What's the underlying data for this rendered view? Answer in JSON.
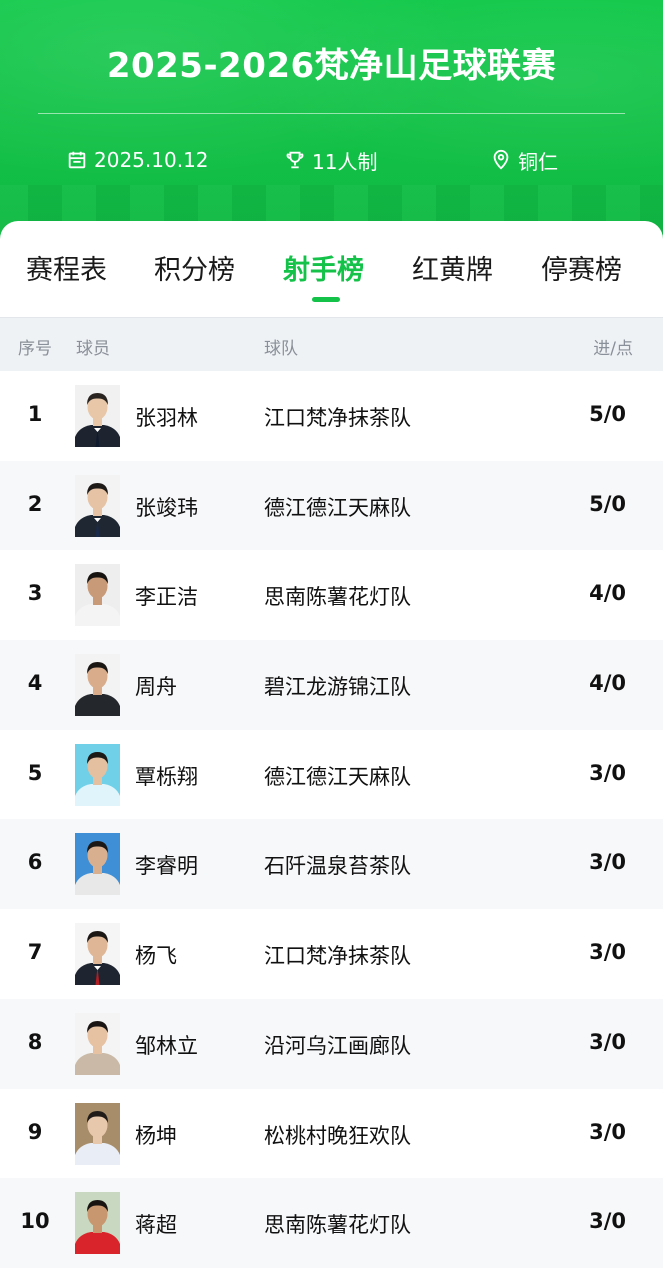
{
  "header": {
    "title": "2025-2026梵净山足球联赛",
    "date": "2025.10.12",
    "format": "11人制",
    "location": "铜仁",
    "icons": {
      "date": "calendar-icon",
      "format": "trophy-icon",
      "location": "location-pin-icon"
    },
    "colors": {
      "brand": "#14c24a"
    }
  },
  "tabs": [
    {
      "label": "赛程表",
      "active": false
    },
    {
      "label": "积分榜",
      "active": false
    },
    {
      "label": "射手榜",
      "active": true
    },
    {
      "label": "红黄牌",
      "active": false
    },
    {
      "label": "停赛榜",
      "active": false
    }
  ],
  "table": {
    "headers": {
      "rank": "序号",
      "player": "球员",
      "team": "球队",
      "goals": "进/点"
    },
    "rows": [
      {
        "rank": "1",
        "name": "张羽林",
        "team": "江口梵净抹茶队",
        "score": "5/0"
      },
      {
        "rank": "2",
        "name": "张竣玮",
        "team": "德江德江天麻队",
        "score": "5/0"
      },
      {
        "rank": "3",
        "name": "李正洁",
        "team": "思南陈薯花灯队",
        "score": "4/0"
      },
      {
        "rank": "4",
        "name": "周舟",
        "team": "碧江龙游锦江队",
        "score": "4/0"
      },
      {
        "rank": "5",
        "name": "覃栎翔",
        "team": "德江德江天麻队",
        "score": "3/0"
      },
      {
        "rank": "6",
        "name": "李睿明",
        "team": "石阡温泉苔茶队",
        "score": "3/0"
      },
      {
        "rank": "7",
        "name": "杨飞",
        "team": "江口梵净抹茶队",
        "score": "3/0"
      },
      {
        "rank": "8",
        "name": "邹林立",
        "team": "沿河乌江画廊队",
        "score": "3/0"
      },
      {
        "rank": "9",
        "name": "杨坤",
        "team": "松桃村晚狂欢队",
        "score": "3/0"
      },
      {
        "rank": "10",
        "name": "蒋超",
        "team": "思南陈薯花灯队",
        "score": "3/0"
      }
    ]
  }
}
